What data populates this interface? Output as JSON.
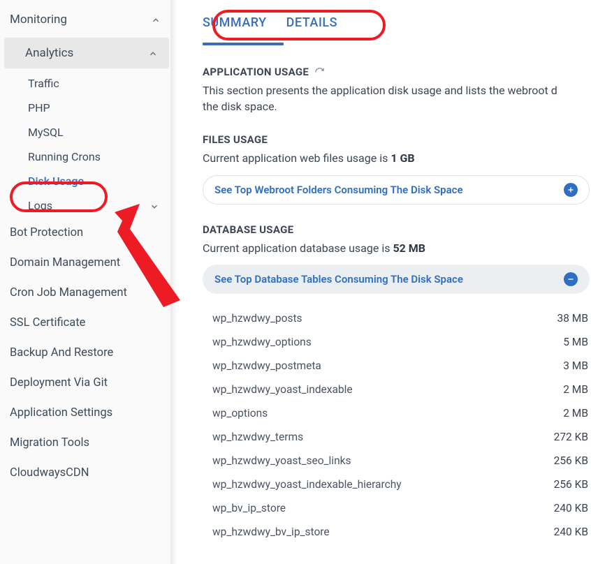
{
  "sidebar": {
    "monitoring": "Monitoring",
    "analytics": "Analytics",
    "sub": {
      "traffic": "Traffic",
      "php": "PHP",
      "mysql": "MySQL",
      "crons": "Running Crons",
      "disk": "Disk Usage",
      "logs": "Logs"
    },
    "items": {
      "bot": "Bot Protection",
      "domain": "Domain Management",
      "cron": "Cron Job Management",
      "ssl": "SSL Certificate",
      "backup": "Backup And Restore",
      "deploy": "Deployment Via Git",
      "appset": "Application Settings",
      "migration": "Migration Tools",
      "cdn": "CloudwaysCDN"
    }
  },
  "tabs": {
    "summary": "SUMMARY",
    "details": "DETAILS"
  },
  "app_usage": {
    "title": "APPLICATION USAGE",
    "desc_a": "This section presents the application disk usage and lists the webroot d",
    "desc_b": "the disk space."
  },
  "files_usage": {
    "title": "FILES USAGE",
    "lead": "Current application web files usage is ",
    "value": "1 GB",
    "expand": "See Top Webroot Folders Consuming The Disk Space"
  },
  "db_usage": {
    "title": "DATABASE USAGE",
    "lead": "Current application database usage is ",
    "value": "52 MB",
    "expand": "See Top Database Tables Consuming The Disk Space",
    "rows": [
      {
        "name": "wp_hzwdwy_posts",
        "size": "38 MB"
      },
      {
        "name": "wp_hzwdwy_options",
        "size": "5 MB"
      },
      {
        "name": "wp_hzwdwy_postmeta",
        "size": "3 MB"
      },
      {
        "name": "wp_hzwdwy_yoast_indexable",
        "size": "2 MB"
      },
      {
        "name": "wp_options",
        "size": "2 MB"
      },
      {
        "name": "wp_hzwdwy_terms",
        "size": "272 KB"
      },
      {
        "name": "wp_hzwdwy_yoast_seo_links",
        "size": "256 KB"
      },
      {
        "name": "wp_hzwdwy_yoast_indexable_hierarchy",
        "size": "256 KB"
      },
      {
        "name": "wp_bv_ip_store",
        "size": "240 KB"
      },
      {
        "name": "wp_hzwdwy_bv_ip_store",
        "size": "240 KB"
      }
    ]
  }
}
